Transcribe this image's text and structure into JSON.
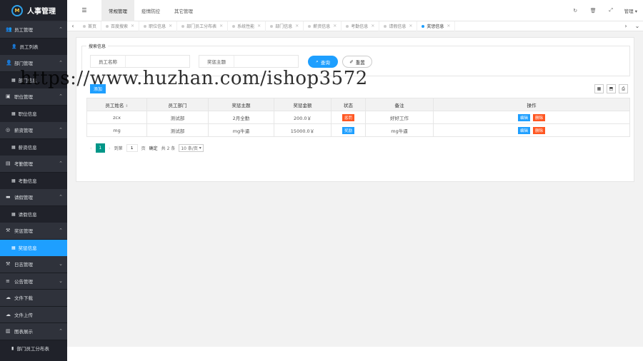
{
  "app": {
    "logo_text": "人事管理",
    "logo_mark": "M"
  },
  "topbar": {
    "tabs": [
      {
        "label": "常规管理"
      },
      {
        "label": "疫情防控"
      },
      {
        "label": "其它管理"
      }
    ],
    "user_label": "管理"
  },
  "sidebar": {
    "items": [
      {
        "type": "head",
        "label": "员工管理",
        "icon": "user-group-icon",
        "glyph": "👥",
        "expanded": true
      },
      {
        "type": "sub",
        "label": "员工列表",
        "icon": "user-icon",
        "glyph": "👤"
      },
      {
        "type": "head",
        "label": "部门管理",
        "icon": "user-icon",
        "glyph": "👤",
        "expanded": true
      },
      {
        "type": "sub",
        "label": "部门信息",
        "icon": "table-icon",
        "glyph": "▦"
      },
      {
        "type": "head",
        "label": "职位管理",
        "icon": "briefcase-icon",
        "glyph": "▣",
        "expanded": true
      },
      {
        "type": "sub",
        "label": "职位信息",
        "icon": "table-icon",
        "glyph": "▦"
      },
      {
        "type": "head",
        "label": "薪资管理",
        "icon": "coin-icon",
        "glyph": "◎",
        "expanded": true
      },
      {
        "type": "sub",
        "label": "薪资信息",
        "icon": "table-icon",
        "glyph": "▦"
      },
      {
        "type": "head",
        "label": "考勤管理",
        "icon": "calendar-icon",
        "glyph": "▤",
        "expanded": true
      },
      {
        "type": "sub",
        "label": "考勤信息",
        "icon": "table-icon",
        "glyph": "▦"
      },
      {
        "type": "head",
        "label": "请假管理",
        "icon": "bed-icon",
        "glyph": "▬",
        "expanded": true
      },
      {
        "type": "sub",
        "label": "请假信息",
        "icon": "table-icon",
        "glyph": "▦"
      },
      {
        "type": "head",
        "label": "奖惩管理",
        "icon": "gavel-icon",
        "glyph": "⚒",
        "expanded": true
      },
      {
        "type": "sub",
        "label": "奖惩信息",
        "icon": "table-icon",
        "glyph": "▦",
        "active": true
      },
      {
        "type": "head",
        "label": "日志管理",
        "icon": "gavel-icon",
        "glyph": "⚒",
        "expanded": false
      },
      {
        "type": "head",
        "label": "公告管理",
        "icon": "list-icon",
        "glyph": "≡",
        "expanded": false
      },
      {
        "type": "head",
        "label": "文件下载",
        "icon": "cloud-icon",
        "glyph": "☁",
        "expanded": null
      },
      {
        "type": "head",
        "label": "文件上传",
        "icon": "cloud-icon",
        "glyph": "☁",
        "expanded": null
      },
      {
        "type": "head",
        "label": "图表展示",
        "icon": "chart-icon",
        "glyph": "▥",
        "expanded": true
      },
      {
        "type": "sub",
        "label": "部门员工分布表",
        "icon": "bar-chart-icon",
        "glyph": "▮"
      }
    ]
  },
  "tabstrip": {
    "tabs": [
      {
        "label": "首页"
      },
      {
        "label": "百度搜索"
      },
      {
        "label": "职位信息"
      },
      {
        "label": "部门员工分布表"
      },
      {
        "label": "系统性能"
      },
      {
        "label": "部门信息"
      },
      {
        "label": "薪资信息"
      },
      {
        "label": "考勤信息"
      },
      {
        "label": "请假信息"
      },
      {
        "label": "奖惩信息",
        "active": true
      }
    ]
  },
  "search": {
    "legend": "搜索信息",
    "fields": [
      {
        "label": "员工名称",
        "value": ""
      },
      {
        "label": "奖惩主题",
        "value": ""
      }
    ],
    "search_label": "查询",
    "reset_label": "重置"
  },
  "toolbar": {
    "add_label": "添加"
  },
  "table": {
    "headers": [
      "员工姓名",
      "员工部门",
      "奖惩主题",
      "奖惩金额",
      "状态",
      "备注",
      "操作"
    ],
    "rows": [
      {
        "name": "zcx",
        "dept": "测试部",
        "topic": "2月全勤",
        "amount": "200.0￥",
        "status": "惩罚",
        "status_color": "#ff5722",
        "note": "好好工作"
      },
      {
        "name": "mg",
        "dept": "测试部",
        "topic": "mg牛逼",
        "amount": "15000.0￥",
        "status": "奖励",
        "status_color": "#1e9fff",
        "note": "mg牛逼"
      }
    ],
    "edit_label": "编辑",
    "delete_label": "删除"
  },
  "pager": {
    "current_page": "1",
    "goto_label": "到第",
    "goto_value": "1",
    "page_unit": "页",
    "confirm_label": "确定",
    "total_label": "共 2 条",
    "page_size_label": "10 条/页"
  },
  "watermark": "https://www.huzhan.com/ishop3572",
  "colors": {
    "accent": "#1e9fff",
    "danger": "#ff5722",
    "sidebar_bg": "#20222a",
    "pager_active": "#009688"
  }
}
